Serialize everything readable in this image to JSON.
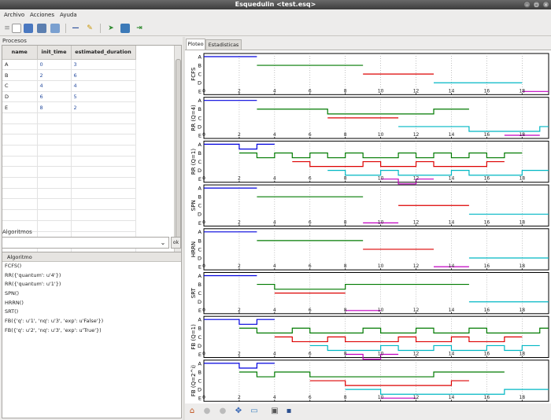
{
  "window": {
    "title": "Esquedulin <test.esq>"
  },
  "menu": {
    "items": [
      "Archivo",
      "Acciones",
      "Ayuda"
    ]
  },
  "left": {
    "procesos_title": "Procesos",
    "table": {
      "headers": [
        "name",
        "init_time",
        "estimated_duration"
      ],
      "rows": [
        [
          "A",
          "0",
          "3"
        ],
        [
          "B",
          "2",
          "6"
        ],
        [
          "C",
          "4",
          "4"
        ],
        [
          "D",
          "6",
          "5"
        ],
        [
          "E",
          "8",
          "2"
        ]
      ]
    },
    "algoritmos_title": "Algoritmos",
    "combo_value": "",
    "ok_label": "ok",
    "alg_header": "Algoritmo",
    "algorithms": [
      "FCFS()",
      "RR({'quantum': u'4'})",
      "RR({'quantum': u'1'})",
      "SPN()",
      "HRRN()",
      "SRT()",
      "FB({'q': u'1', 'nq': u'3', 'exp': u'False'})",
      "FB({'q': u'2', 'nq': u'3', 'exp': u'True'})"
    ]
  },
  "tabs": [
    {
      "label": "Ploteo",
      "active": true
    },
    {
      "label": "Estadisticas",
      "active": false
    }
  ],
  "colors": {
    "A": "#0000dd",
    "B": "#007a00",
    "C": "#dd0000",
    "D": "#00b7c4",
    "E": "#c000c0"
  },
  "chart_data": [
    {
      "type": "line",
      "title": "FCFS",
      "processes": [
        "A",
        "B",
        "C",
        "D",
        "E"
      ],
      "xlim": [
        0,
        19.5
      ],
      "segments": {
        "A": [
          [
            0,
            3
          ]
        ],
        "B": [
          [
            3,
            9
          ]
        ],
        "C": [
          [
            9,
            13
          ]
        ],
        "D": [
          [
            13,
            18
          ]
        ],
        "E": [
          [
            18,
            20
          ]
        ]
      }
    },
    {
      "type": "line",
      "title": "RR (Q=4)",
      "processes": [
        "A",
        "B",
        "C",
        "D",
        "E"
      ],
      "xlim": [
        0,
        19.5
      ],
      "segments": {
        "A": [
          [
            0,
            3
          ]
        ],
        "B": [
          [
            3,
            7
          ],
          [
            13,
            15
          ]
        ],
        "C": [
          [
            7,
            11
          ]
        ],
        "D": [
          [
            11,
            15
          ],
          [
            19,
            20
          ]
        ],
        "E": [
          [
            17,
            19
          ]
        ]
      }
    },
    {
      "type": "line",
      "title": "RR (Q=1)",
      "processes": [
        "A",
        "B",
        "C",
        "D",
        "E"
      ],
      "xlim": [
        0,
        19.5
      ],
      "segments": {
        "A": [
          [
            0,
            2
          ],
          [
            3,
            4
          ]
        ],
        "B": [
          [
            2,
            3
          ],
          [
            4,
            5
          ],
          [
            6,
            7
          ],
          [
            8,
            9
          ],
          [
            11,
            12
          ],
          [
            13,
            14
          ],
          [
            15,
            16
          ],
          [
            17,
            18
          ]
        ],
        "C": [
          [
            5,
            6
          ],
          [
            9,
            10
          ],
          [
            12,
            13
          ],
          [
            16,
            17
          ]
        ],
        "D": [
          [
            7,
            8
          ],
          [
            10,
            11
          ],
          [
            14,
            15
          ],
          [
            18,
            20
          ]
        ],
        "E": [
          [
            10,
            11
          ],
          [
            12,
            13
          ]
        ]
      }
    },
    {
      "type": "line",
      "title": "SPN",
      "processes": [
        "A",
        "B",
        "C",
        "D",
        "E"
      ],
      "xlim": [
        0,
        19.5
      ],
      "segments": {
        "A": [
          [
            0,
            3
          ]
        ],
        "B": [
          [
            3,
            9
          ]
        ],
        "C": [
          [
            11,
            15
          ]
        ],
        "D": [
          [
            15,
            20
          ]
        ],
        "E": [
          [
            9,
            11
          ]
        ]
      }
    },
    {
      "type": "line",
      "title": "HRRN",
      "processes": [
        "A",
        "B",
        "C",
        "D",
        "E"
      ],
      "xlim": [
        0,
        19.5
      ],
      "segments": {
        "A": [
          [
            0,
            3
          ]
        ],
        "B": [
          [
            3,
            9
          ]
        ],
        "C": [
          [
            9,
            13
          ]
        ],
        "D": [
          [
            15,
            20
          ]
        ],
        "E": [
          [
            13,
            15
          ]
        ]
      }
    },
    {
      "type": "line",
      "title": "SRT",
      "processes": [
        "A",
        "B",
        "C",
        "D",
        "E"
      ],
      "xlim": [
        0,
        19.5
      ],
      "segments": {
        "A": [
          [
            0,
            3
          ]
        ],
        "B": [
          [
            3,
            4
          ],
          [
            8,
            15
          ]
        ],
        "C": [
          [
            4,
            8
          ]
        ],
        "D": [
          [
            15,
            20
          ]
        ],
        "E": [
          [
            8,
            10
          ]
        ]
      }
    },
    {
      "type": "line",
      "title": "FB (Q=1)",
      "processes": [
        "A",
        "B",
        "C",
        "D",
        "E"
      ],
      "xlim": [
        0,
        19.5
      ],
      "segments": {
        "A": [
          [
            0,
            2
          ],
          [
            3,
            4
          ]
        ],
        "B": [
          [
            2,
            3
          ],
          [
            5,
            6
          ],
          [
            9,
            10
          ],
          [
            12,
            13
          ],
          [
            15,
            16
          ],
          [
            19,
            20
          ]
        ],
        "C": [
          [
            4,
            5
          ],
          [
            7,
            8
          ],
          [
            11,
            12
          ],
          [
            14,
            15
          ],
          [
            17,
            18
          ]
        ],
        "D": [
          [
            6,
            7
          ],
          [
            10,
            11
          ],
          [
            13,
            14
          ],
          [
            16,
            17
          ],
          [
            18,
            19
          ]
        ],
        "E": [
          [
            8,
            9
          ],
          [
            10,
            11
          ]
        ]
      }
    },
    {
      "type": "line",
      "title": "FB (Q=2^i)",
      "processes": [
        "A",
        "B",
        "C",
        "D",
        "E"
      ],
      "xlim": [
        0,
        19.5
      ],
      "segments": {
        "A": [
          [
            0,
            2
          ],
          [
            3,
            4
          ]
        ],
        "B": [
          [
            2,
            3
          ],
          [
            4,
            6
          ],
          [
            13,
            17
          ]
        ],
        "C": [
          [
            6,
            8
          ],
          [
            14,
            15
          ]
        ],
        "D": [
          [
            8,
            10
          ],
          [
            17,
            20
          ]
        ],
        "E": [
          [
            10,
            12
          ]
        ]
      }
    }
  ],
  "x_ticks": [
    "0",
    "2",
    "4",
    "6",
    "8",
    "10",
    "12",
    "14",
    "16",
    "18"
  ],
  "toolbar": {
    "icons": [
      "new-file-icon",
      "open-icon",
      "save-icon",
      "save-as-icon",
      "remove-icon",
      "wand-icon",
      "run-icon",
      "refresh-icon",
      "exit-icon"
    ]
  },
  "nav": {
    "icons": [
      "home-icon",
      "back-icon",
      "forward-icon",
      "pan-icon",
      "zoom-icon",
      "configure-icon",
      "save-figure-icon"
    ]
  }
}
